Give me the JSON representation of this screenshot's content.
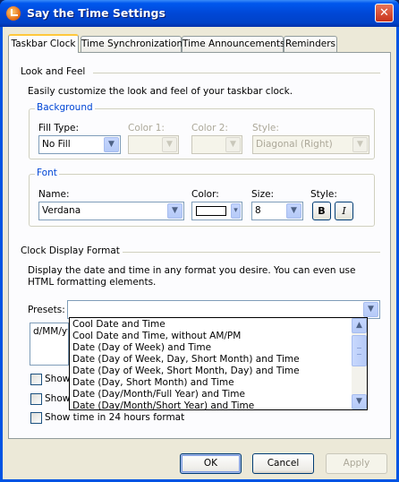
{
  "window": {
    "title": "Say the Time Settings",
    "close_glyph": "✕"
  },
  "tabs": [
    {
      "label": "Taskbar Clock",
      "active": true
    },
    {
      "label": "Time Synchronization",
      "active": false
    },
    {
      "label": "Time Announcements",
      "active": false
    },
    {
      "label": "Reminders",
      "active": false
    }
  ],
  "look_and_feel": {
    "heading": "Look and Feel",
    "description": "Easily customize the look and feel of your taskbar clock."
  },
  "background": {
    "group_label": "Background",
    "fill_type_label": "Fill Type:",
    "fill_type_value": "No Fill",
    "color1_label": "Color 1:",
    "color2_label": "Color 2:",
    "style_label": "Style:",
    "style_value": "Diagonal (Right)"
  },
  "font": {
    "group_label": "Font",
    "name_label": "Name:",
    "name_value": "Verdana",
    "color_label": "Color:",
    "color_value": "#FFFFFF",
    "size_label": "Size:",
    "size_value": "8",
    "style_label": "Style:",
    "bold_label": "B",
    "italic_label": "I"
  },
  "clock_display": {
    "heading": "Clock Display Format",
    "description": "Display the date and time in any format you desire. You can even use HTML formatting elements.",
    "presets_label": "Presets:",
    "presets_value": "",
    "format_value": "d/MM/yy",
    "presets_options": [
      "Cool Date and Time",
      "Cool Date and Time, without AM/PM",
      "Date (Day of Week) and Time",
      "Date (Day of Week, Day, Short Month) and Time",
      "Date (Day of Week, Short Month, Day) and Time",
      "Date (Day, Short Month) and Time",
      "Date (Day/Month/Full Year) and Time",
      "Date (Day/Month/Short Year) and Time"
    ],
    "check1_label": "Show",
    "check2_label": "Show",
    "check3_label": "Show time in 24 hours format"
  },
  "buttons": {
    "ok": "OK",
    "cancel": "Cancel",
    "apply": "Apply"
  },
  "colors": {
    "title_bar": "#0054E3",
    "dialog_bg": "#ECE9D8",
    "group_label": "#0046D5",
    "tab_highlight": "#FFC83C"
  }
}
